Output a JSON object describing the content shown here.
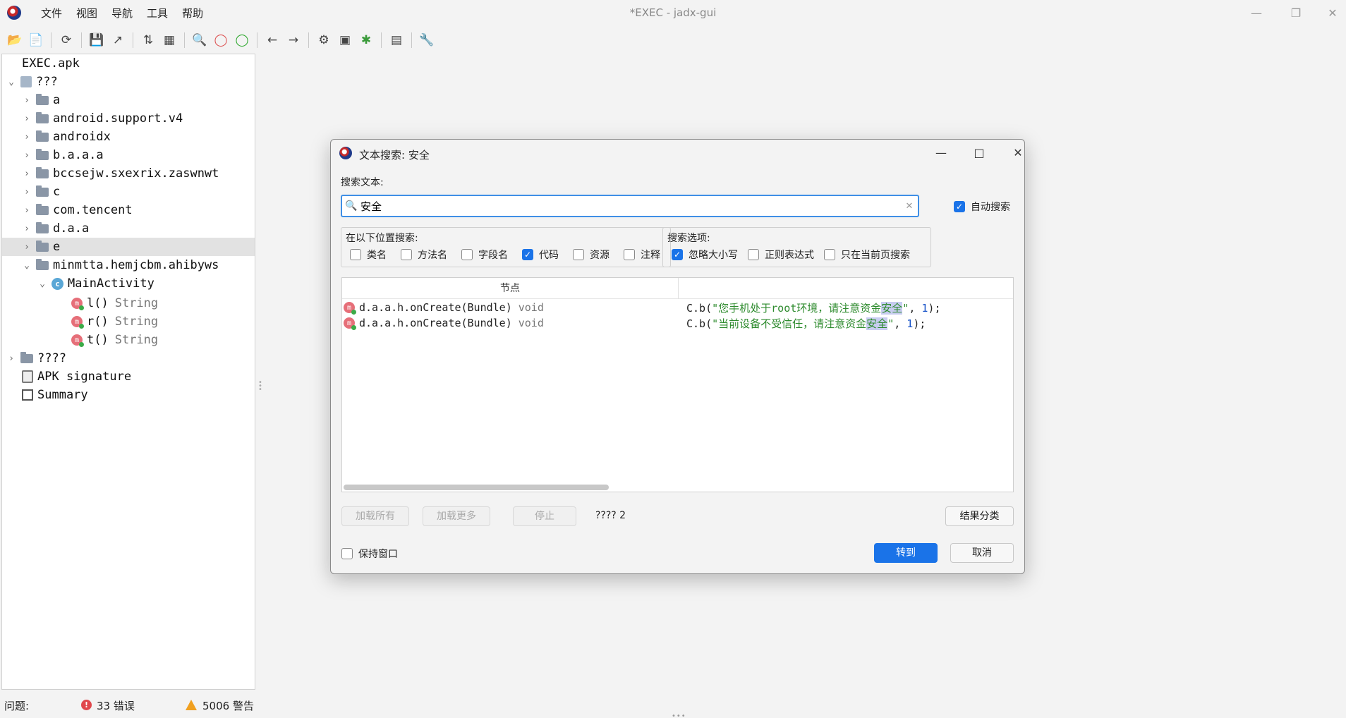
{
  "window": {
    "title": "*EXEC - jadx-gui",
    "menu": [
      "文件",
      "视图",
      "导航",
      "工具",
      "帮助"
    ]
  },
  "tree": {
    "root": "EXEC.apk",
    "source_node": "???",
    "packages": [
      "a",
      "android.support.v4",
      "androidx",
      "b.a.a.a",
      "bccsejw.sxexrix.zaswnwt",
      "c",
      "com.tencent",
      "d.a.a",
      "e",
      "minmtta.hemjcbm.ahibyws"
    ],
    "class_name": "MainActivity",
    "methods": [
      {
        "name": "l()",
        "type": "String"
      },
      {
        "name": "r()",
        "type": "String"
      },
      {
        "name": "t()",
        "type": "String"
      }
    ],
    "resources_node": "????",
    "apk_signature": "APK signature",
    "summary": "Summary"
  },
  "status": {
    "label": "问题:",
    "errors": "33 错误",
    "warnings": "5006 警告"
  },
  "dialog": {
    "title": "文本搜索: 安全",
    "search_label": "搜索文本:",
    "search_value": "安全",
    "auto_search": "自动搜索",
    "location_title": "在以下位置搜索:",
    "locations": [
      {
        "label": "类名",
        "checked": false
      },
      {
        "label": "方法名",
        "checked": false
      },
      {
        "label": "字段名",
        "checked": false
      },
      {
        "label": "代码",
        "checked": true
      },
      {
        "label": "资源",
        "checked": false
      },
      {
        "label": "注释",
        "checked": false
      }
    ],
    "options_title": "搜索选项:",
    "options": [
      {
        "label": "忽略大小写",
        "checked": true
      },
      {
        "label": "正则表达式",
        "checked": false
      },
      {
        "label": "只在当前页搜索",
        "checked": false
      }
    ],
    "column_node": "节点",
    "results": [
      {
        "node": "d.a.a.h.onCreate(Bundle)",
        "ret": "void",
        "code_pre": "C.b(",
        "str_pre": "\"您手机处于root环境，请注意资金",
        "str_hl": "安全",
        "str_post": "\"",
        "code_mid": ", ",
        "num": "1",
        "code_post": ");"
      },
      {
        "node": "d.a.a.h.onCreate(Bundle)",
        "ret": "void",
        "code_pre": "C.b(",
        "str_pre": "\"当前设备不受信任，请注意资金",
        "str_hl": "安全",
        "str_post": "\"",
        "code_mid": ", ",
        "num": "1",
        "code_post": ");"
      }
    ],
    "btn_load_all": "加载所有",
    "btn_load_more": "加载更多",
    "btn_stop": "停止",
    "result_count": "???? 2",
    "btn_group": "结果分类",
    "keep_window": "保持窗口",
    "btn_goto": "转到",
    "btn_cancel": "取消"
  }
}
